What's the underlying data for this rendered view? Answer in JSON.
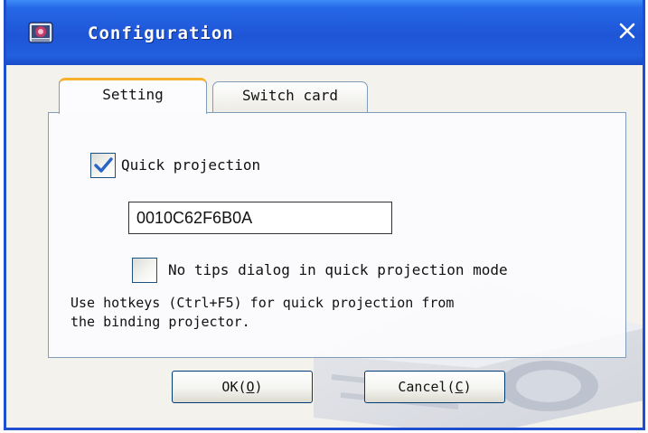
{
  "window": {
    "title": "Configuration",
    "icons": {
      "app": "projector-app-icon",
      "close": "close-icon"
    }
  },
  "tabs": [
    {
      "label": "Setting",
      "active": true
    },
    {
      "label": "Switch card",
      "active": false
    }
  ],
  "settings": {
    "quick_projection": {
      "label": "Quick projection",
      "checked": true
    },
    "mac_address": {
      "value": "0010C62F6B0A"
    },
    "no_tips": {
      "label": "No tips dialog in quick projection mode",
      "checked": false
    },
    "hint_line1": "Use hotkeys (Ctrl+F5) for quick projection from",
    "hint_line2": "the binding projector."
  },
  "buttons": {
    "ok": {
      "label": "OK",
      "accel": "O"
    },
    "cancel": {
      "label": "Cancel",
      "accel": "C"
    }
  },
  "colors": {
    "titlebar": "#1e55d6",
    "check_mark": "#2a63c6",
    "active_tab_accent": "#f7b22b"
  }
}
